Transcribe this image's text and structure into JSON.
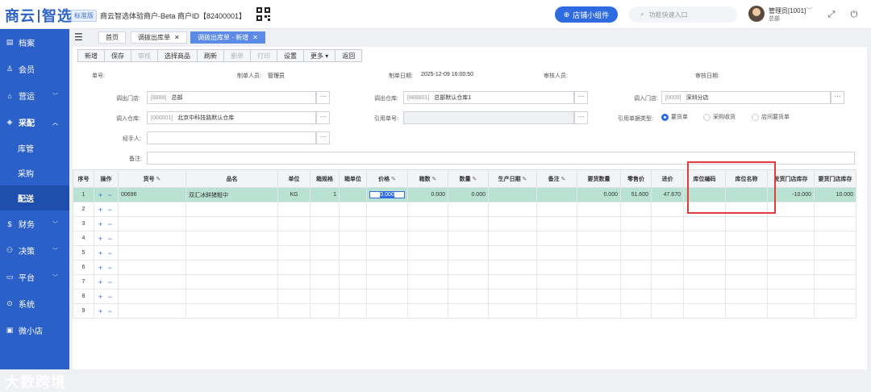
{
  "topbar": {
    "brand_left": "商云",
    "brand_right": "智选",
    "edition": "标准版",
    "tenant": "商云智选体验商户-Beta  商户ID【82400001】",
    "widget_button": "店铺小组件",
    "search_placeholder": "功能快速入口",
    "user_name": "管理员[1001]",
    "user_role": "总部"
  },
  "sidebar": {
    "items": [
      {
        "icon": "archive-icon",
        "glyph": "▤",
        "label": "档案"
      },
      {
        "icon": "member-icon",
        "glyph": "♙",
        "label": "会员"
      },
      {
        "icon": "operation-icon",
        "glyph": "⌂",
        "label": "营运",
        "chevron": "﹀"
      },
      {
        "icon": "purchase-icon",
        "glyph": "◈",
        "label": "采配",
        "chevron": "︿"
      }
    ],
    "subitems": [
      "库管",
      "采购",
      "配送"
    ],
    "items2": [
      {
        "icon": "finance-icon",
        "glyph": "$",
        "label": "财务",
        "chevron": "﹀"
      },
      {
        "icon": "decision-icon",
        "glyph": "⚇",
        "label": "决策",
        "chevron": "﹀"
      },
      {
        "icon": "platform-icon",
        "glyph": "▭",
        "label": "平台",
        "chevron": "﹀"
      },
      {
        "icon": "system-icon",
        "glyph": "⊙",
        "label": "系统"
      },
      {
        "icon": "mini-store-icon",
        "glyph": "▣",
        "label": "微小店"
      }
    ],
    "watermark": "大数跨境"
  },
  "tabs": [
    {
      "label": "首页",
      "closable": false
    },
    {
      "label": "调拨出库单",
      "closable": true
    },
    {
      "label": "调拨出库单 - 新增",
      "closable": true
    }
  ],
  "toolbar": [
    {
      "label": "新增",
      "enabled": true
    },
    {
      "label": "保存",
      "enabled": true
    },
    {
      "label": "审核",
      "enabled": false
    },
    {
      "label": "选择商品",
      "enabled": true
    },
    {
      "label": "刷新",
      "enabled": true
    },
    {
      "label": "删单",
      "enabled": false
    },
    {
      "label": "打印",
      "enabled": false
    },
    {
      "label": "设置",
      "enabled": true
    },
    {
      "label": "更多 ▾",
      "enabled": true
    },
    {
      "label": "返回",
      "enabled": true
    }
  ],
  "info": {
    "doc_no_label": "单号:",
    "maker_label": "制单人员:",
    "maker_value": "管理员",
    "date_label": "制单日期:",
    "date_value": "2025-12-09 16:00:50",
    "auditor_label": "审核人员:",
    "audit_date_label": "审核日期:"
  },
  "form": {
    "out_store_label": "调出门店:",
    "out_store_code": "[8888]",
    "out_store_name": "总部",
    "out_wh_label": "调出仓库:",
    "out_wh_code": "[888801]",
    "out_wh_name": "总部默认仓库1",
    "in_store_label": "调入门店:",
    "in_store_code": "[0000]",
    "in_store_name": "深圳分店",
    "in_wh_label": "调入仓库:",
    "in_wh_code": "[000001]",
    "in_wh_name": "北京中科技路默认仓库",
    "ref_no_label": "引用单号:",
    "ref_type_label": "引用单据类型:",
    "ref_types": [
      {
        "label": "要货单",
        "checked": true
      },
      {
        "label": "采购收货",
        "checked": false
      },
      {
        "label": "店间要货单",
        "checked": false
      }
    ],
    "handler_label": "经手人:",
    "remark_label": "备注:",
    "dots": "···"
  },
  "grid": {
    "headers": [
      "序号",
      "操作",
      "货号",
      "品名",
      "单位",
      "箱规格",
      "箱单位",
      "价格",
      "箱数",
      "数量",
      "生产日期",
      "备注",
      "要货数量",
      "零售价",
      "进价",
      "库位编码",
      "库位名称",
      "发货门店库存",
      "要货门店库存"
    ],
    "editable_cols": [
      "货号",
      "价格",
      "箱数",
      "数量",
      "生产日期",
      "备注"
    ],
    "pencil": "✎",
    "row_ops": "+ −",
    "rows": [
      {
        "no": "1",
        "sku": "00696",
        "name": "双汇冰鲜猪粗中",
        "unit": "KG",
        "case_spec": "1",
        "case_unit": "",
        "price": "0.000",
        "cases": "0.000",
        "qty": "0.000",
        "prod_date": "",
        "remark": "",
        "req_qty": "0.000",
        "retail": "51.600",
        "cost": "47.670",
        "loc_code": "",
        "loc_name": "",
        "send_stock": "-10.000",
        "req_stock": "10.000"
      },
      {
        "no": "2"
      },
      {
        "no": "3"
      },
      {
        "no": "4"
      },
      {
        "no": "5"
      },
      {
        "no": "6"
      },
      {
        "no": "7"
      },
      {
        "no": "8"
      },
      {
        "no": "9"
      }
    ]
  },
  "colors": {
    "brand": "#2e62c8",
    "sidebar": "#2a60c8",
    "selected_row": "#b9e2d2",
    "highlight_box": "#e23c3c"
  }
}
